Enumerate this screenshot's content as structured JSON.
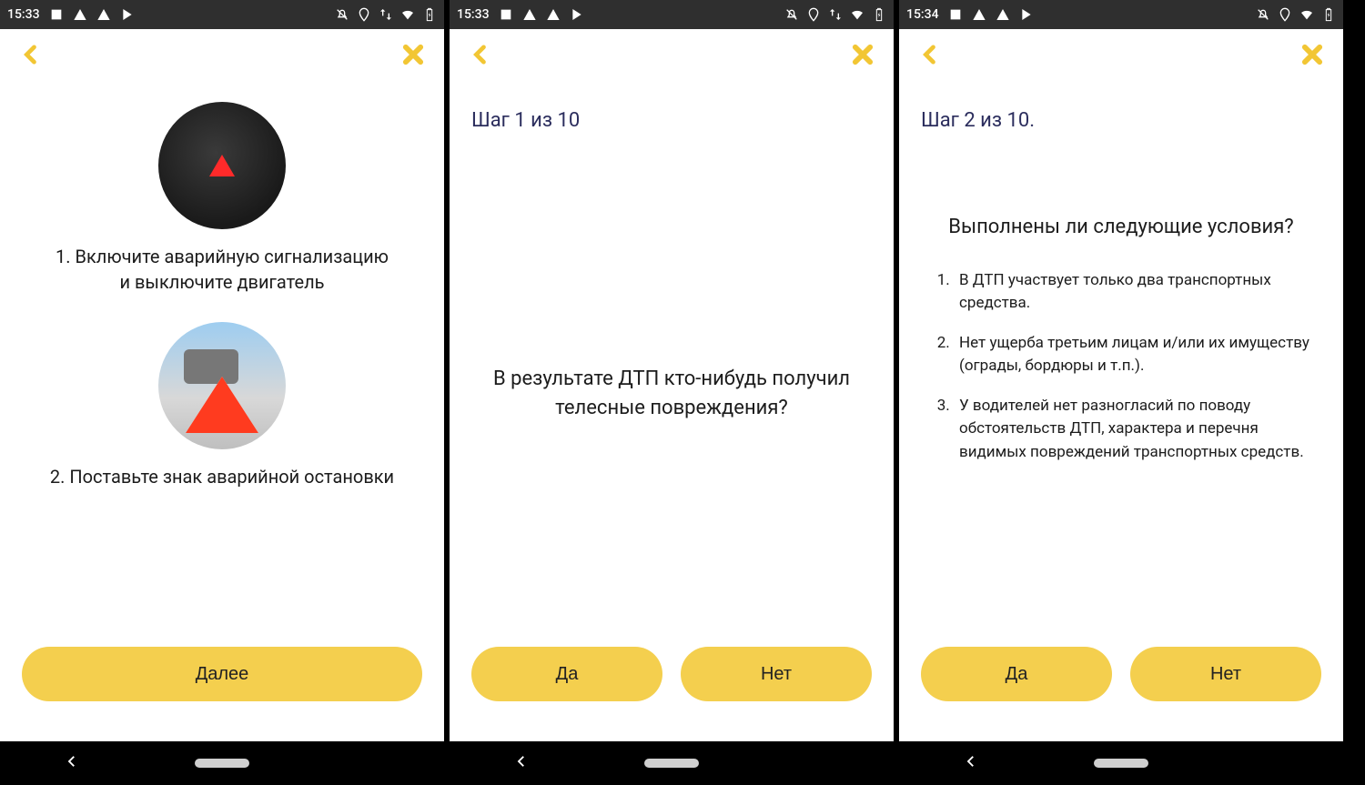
{
  "screens": [
    {
      "status": {
        "time": "15:33"
      },
      "steps": [
        {
          "text": "1. Включите аварийную сигнализацию и выключите двигатель"
        },
        {
          "text": "2. Поставьте знак аварийной остановки"
        }
      ],
      "cta": "Далее"
    },
    {
      "status": {
        "time": "15:33"
      },
      "step_title": "Шаг 1 из 10",
      "question": "В результате ДТП кто-нибудь получил телесные повреждения?",
      "yes": "Да",
      "no": "Нет"
    },
    {
      "status": {
        "time": "15:34"
      },
      "step_title": "Шаг 2 из 10.",
      "cond_title": "Выполнены ли следующие условия?",
      "conditions": [
        "В ДТП участвует только два транспортных средства.",
        "Нет ущерба третьим лицам и/или их имуществу (ограды, бордюры и т.п.).",
        "У водителей нет разногласий по поводу обстоятельств ДТП, характера и перечня видимых повреждений транспортных средств."
      ],
      "yes": "Да",
      "no": "Нет"
    }
  ],
  "status_icons": [
    "image-icon",
    "warning-icon",
    "warning-icon",
    "play-icon"
  ],
  "status_right_icons_a": [
    "bell-off-icon",
    "location-icon",
    "swap-icon",
    "wifi-icon",
    "battery-icon"
  ],
  "status_right_icons_b": [
    "bell-off-icon",
    "location-icon",
    "wifi-icon",
    "battery-icon"
  ]
}
